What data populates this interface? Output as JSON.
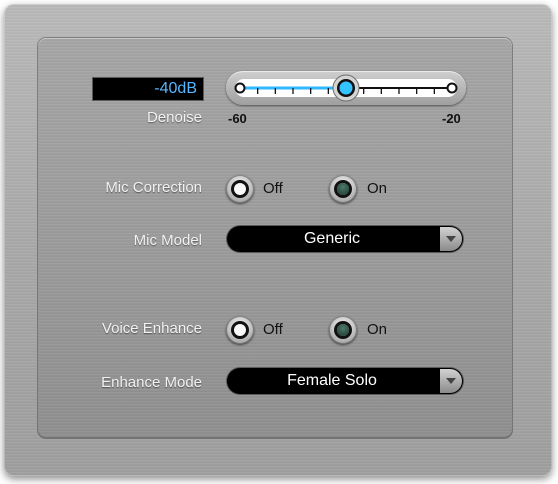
{
  "denoise": {
    "label": "Denoise",
    "value_text": "-40dB",
    "min_label": "-60",
    "max_label": "-20",
    "value": -40,
    "min": -60,
    "max": -20
  },
  "mic_correction": {
    "label": "Mic Correction",
    "off_label": "Off",
    "on_label": "On",
    "selected": "Off"
  },
  "mic_model": {
    "label": "Mic Model",
    "value": "Generic"
  },
  "voice_enhance": {
    "label": "Voice Enhance",
    "off_label": "Off",
    "on_label": "On",
    "selected": "Off"
  },
  "enhance_mode": {
    "label": "Enhance Mode",
    "value": "Female Solo"
  },
  "colors": {
    "slider_fill": "#2fb8ff",
    "value_text": "#58b6ff",
    "panel": "#9c9c9c"
  }
}
